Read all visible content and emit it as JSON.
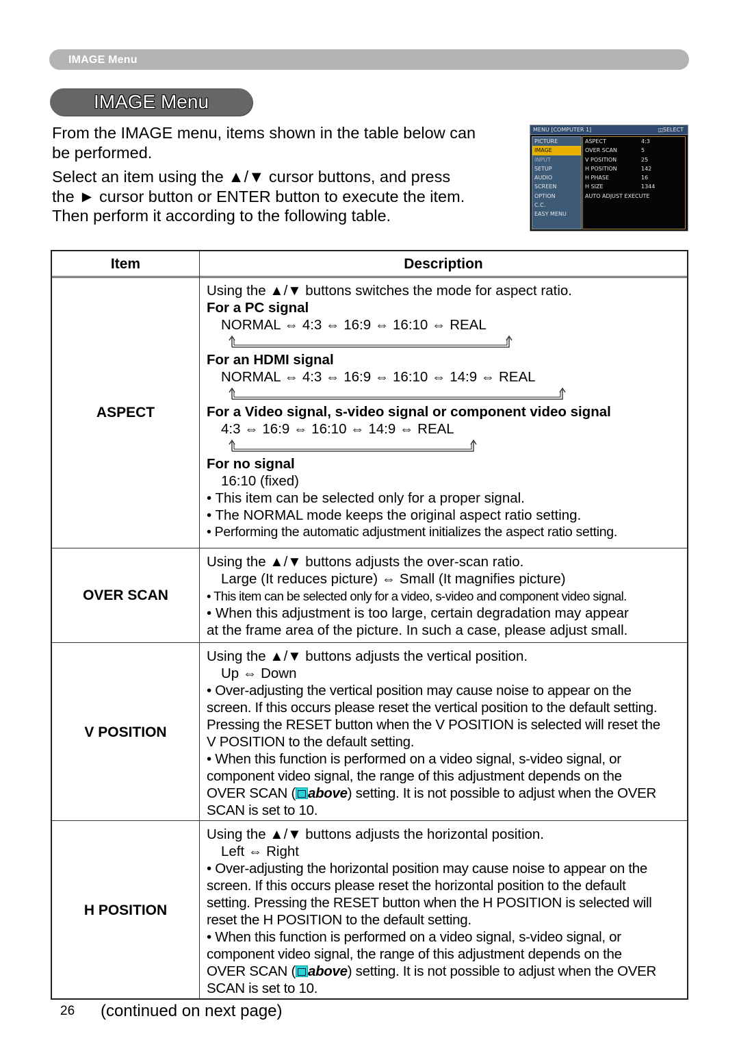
{
  "header": {
    "section_label": "IMAGE Menu"
  },
  "title": "IMAGE Menu",
  "intro": {
    "paragraph1": "From the IMAGE menu, items shown in the table below can be performed.",
    "paragraph2_line1": "Select an item using the ▲/▼ cursor buttons, and press",
    "paragraph2_line2": "the ► cursor button or ENTER button to execute the item.",
    "paragraph2_line3": "Then perform it according to the following table."
  },
  "osd": {
    "title": "MENU [COMPUTER 1]",
    "select_hint": "SELECT",
    "menu_items": [
      "PICTURE",
      "IMAGE",
      "INPUT",
      "SETUP",
      "AUDIO",
      "SCREEN",
      "OPTION",
      "C.C.",
      "EASY MENU"
    ],
    "selected_menu": "IMAGE",
    "settings": [
      {
        "name": "ASPECT",
        "value": "4:3"
      },
      {
        "name": "OVER SCAN",
        "value": "5"
      },
      {
        "name": "V POSITION",
        "value": "25"
      },
      {
        "name": "H POSITION",
        "value": "142"
      },
      {
        "name": "H PHASE",
        "value": "16"
      },
      {
        "name": "H SIZE",
        "value": "1344"
      },
      {
        "name": "AUTO ADJUST EXECUTE",
        "value": ""
      }
    ],
    "colors": {
      "highlight": "#e6b100",
      "sidebar": "#3d5a77",
      "background": "#0b0b0b"
    }
  },
  "table": {
    "headers": {
      "item": "Item",
      "description": "Description"
    },
    "rows": [
      {
        "item": "ASPECT",
        "intro": "Using the ▲/▼ buttons switches the mode for aspect ratio.",
        "pc_heading": "For a PC signal",
        "pc_cycle": "NORMAL ⇔ 4:3 ⇔ 16:9 ⇔ 16:10 ⇔ REAL",
        "hdmi_heading": "For an HDMI signal",
        "hdmi_cycle": "NORMAL ⇔ 4:3 ⇔ 16:9 ⇔ 16:10 ⇔ 14:9 ⇔ REAL",
        "video_heading": "For a Video signal, s-video signal or component video signal",
        "video_cycle": "4:3 ⇔ 16:9 ⇔ 16:10 ⇔ 14:9 ⇔ REAL",
        "nosignal_heading": "For no signal",
        "nosignal_value": "16:10 (fixed)",
        "notes": [
          "• This item can be selected only for a proper signal.",
          "• The NORMAL mode keeps the original aspect ratio setting.",
          "• Performing the automatic adjustment initializes the aspect ratio setting."
        ]
      },
      {
        "item": "OVER SCAN",
        "intro": "Using the ▲/▼ buttons adjusts the over-scan ratio.",
        "range": "Large (It reduces picture) ⇔ Small (It magnifies picture)",
        "notes": [
          "• This item can be selected only for a video, s-video and component video signal.",
          "• When this adjustment is too large, certain degradation may appear",
          "at the frame area of the picture. In such a case, please adjust small."
        ]
      },
      {
        "item": "V POSITION",
        "intro": "Using the ▲/▼ buttons adjusts the vertical position.",
        "range": "Up ⇔ Down",
        "lines": [
          "• Over-adjusting the vertical position may cause noise to appear on the",
          "screen. If this occurs please reset the vertical position to the default setting.",
          "Pressing the RESET button when the V POSITION is selected will reset the",
          "V POSITION to the default setting.",
          "• When this function is performed on a video signal, s-video signal, or",
          "component video signal, the range of this adjustment depends on the"
        ],
        "ref_prefix": "OVER SCAN (",
        "ref_link": "above",
        "ref_suffix": ") setting. It is not possible to adjust when the OVER",
        "last_line": "SCAN is set to 10."
      },
      {
        "item": "H POSITION",
        "intro": "Using the ▲/▼ buttons adjusts the horizontal position.",
        "range": "Left ⇔ Right",
        "lines": [
          "• Over-adjusting the horizontal position may cause noise to appear on the",
          "screen. If this occurs please reset the horizontal position to the default",
          "setting. Pressing the RESET button when the H POSITION is selected will",
          "reset the H POSITION to the default setting.",
          "• When this function is performed on a video signal, s-video signal, or",
          "component video signal, the range of this adjustment depends on the"
        ],
        "ref_prefix": "OVER SCAN (",
        "ref_link": "above",
        "ref_suffix": ") setting. It is not possible to adjust when the OVER",
        "last_line": "SCAN is set to 10."
      }
    ]
  },
  "footer": {
    "page_number": "26",
    "continued": "(continued on next page)"
  }
}
